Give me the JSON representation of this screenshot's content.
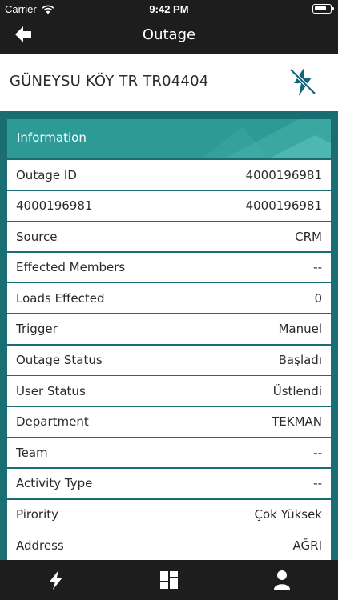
{
  "status_bar": {
    "carrier": "Carrier",
    "time": "9:42 PM"
  },
  "nav": {
    "title": "Outage"
  },
  "header": {
    "name": "GÜNEYSU KÖY TR TR04404"
  },
  "section": {
    "title": "Information"
  },
  "rows": [
    {
      "label": "Outage ID",
      "value": "4000196981"
    },
    {
      "label": "4000196981",
      "value": "4000196981"
    },
    {
      "label": "Source",
      "value": "CRM"
    },
    {
      "label": "Effected Members",
      "value": "--"
    },
    {
      "label": "Loads Effected",
      "value": "0"
    },
    {
      "label": "Trigger",
      "value": "Manuel"
    },
    {
      "label": "Outage Status",
      "value": "Başladı"
    },
    {
      "label": "User Status",
      "value": "Üstlendi"
    },
    {
      "label": "Department",
      "value": "TEKMAN"
    },
    {
      "label": "Team",
      "value": "--"
    },
    {
      "label": "Activity Type",
      "value": "--"
    },
    {
      "label": "Pirority",
      "value": "Çok Yüksek"
    },
    {
      "label": "Address",
      "value": "AĞRI"
    }
  ],
  "tabs": [
    {
      "icon": "lightning-icon"
    },
    {
      "icon": "dashboard-icon"
    },
    {
      "icon": "user-icon"
    }
  ],
  "colors": {
    "bar": "#1d1d1d",
    "teal_dark": "#1a6d73",
    "teal_header": "#2d9a95",
    "icon_blue": "#16647a"
  }
}
